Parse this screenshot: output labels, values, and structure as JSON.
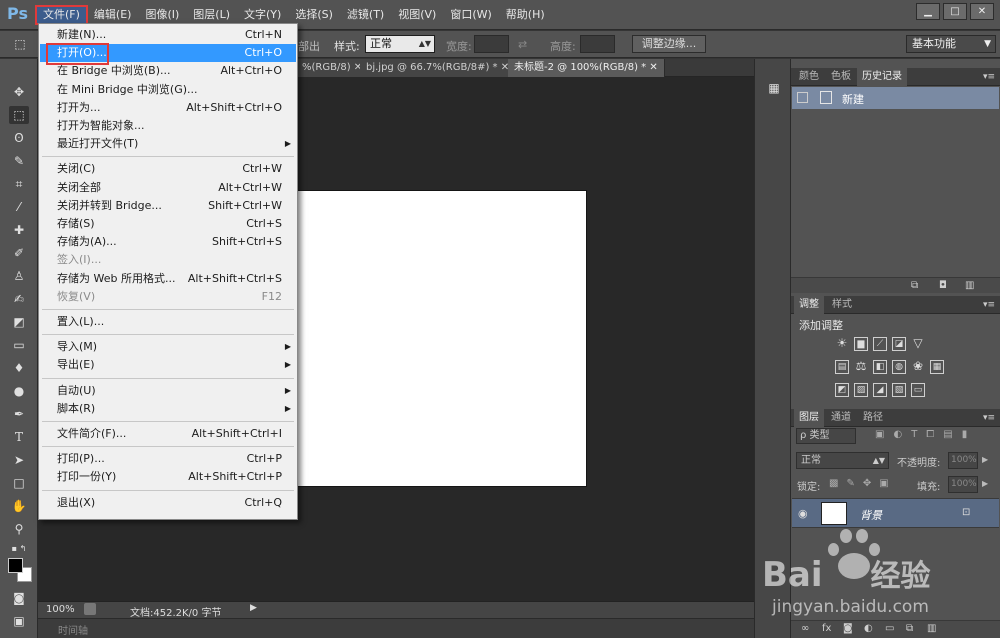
{
  "app": {
    "logo": "Ps"
  },
  "menubar": {
    "items": [
      "文件(F)",
      "编辑(E)",
      "图像(I)",
      "图层(L)",
      "文字(Y)",
      "选择(S)",
      "滤镜(T)",
      "视图(V)",
      "窗口(W)",
      "帮助(H)"
    ],
    "active": "文件(F)"
  },
  "window_controls": [
    "▁",
    "□",
    "✕"
  ],
  "options": {
    "partial_label": "部出",
    "style_label": "样式:",
    "style_value": "正常",
    "width_label": "宽度:",
    "height_label": "高度:",
    "refine_button": "调整边缘...",
    "workspace": "基本功能"
  },
  "tabs": [
    {
      "label": "%(RGB/8)",
      "active": false
    },
    {
      "label": "bj.jpg @ 66.7%(RGB/8#) *",
      "active": false
    },
    {
      "label": "未标题-2 @ 100%(RGB/8) *",
      "active": true
    }
  ],
  "tab_close": "✕",
  "status": {
    "zoom": "100%",
    "doc_size": "文档:452.2K/0 字节"
  },
  "timeline": {
    "label": "时间轴"
  },
  "file_menu": {
    "items": [
      {
        "label": "新建(N)...",
        "shortcut": "Ctrl+N"
      },
      {
        "label": "打开(O)...",
        "shortcut": "Ctrl+O",
        "highlighted": true
      },
      {
        "label": "在 Bridge 中浏览(B)...",
        "shortcut": "Alt+Ctrl+O"
      },
      {
        "label": "在 Mini Bridge 中浏览(G)...",
        "shortcut": ""
      },
      {
        "label": "打开为...",
        "shortcut": "Alt+Shift+Ctrl+O"
      },
      {
        "label": "打开为智能对象...",
        "shortcut": ""
      },
      {
        "label": "最近打开文件(T)",
        "shortcut": "",
        "submenu": true
      },
      {
        "label": "关闭(C)",
        "shortcut": "Ctrl+W"
      },
      {
        "label": "关闭全部",
        "shortcut": "Alt+Ctrl+W"
      },
      {
        "label": "关闭并转到 Bridge...",
        "shortcut": "Shift+Ctrl+W"
      },
      {
        "label": "存储(S)",
        "shortcut": "Ctrl+S"
      },
      {
        "label": "存储为(A)...",
        "shortcut": "Shift+Ctrl+S"
      },
      {
        "label": "签入(I)...",
        "shortcut": "",
        "disabled": true
      },
      {
        "label": "存储为 Web 所用格式...",
        "shortcut": "Alt+Shift+Ctrl+S"
      },
      {
        "label": "恢复(V)",
        "shortcut": "F12",
        "disabled": true
      },
      {
        "label": "置入(L)...",
        "shortcut": ""
      },
      {
        "label": "导入(M)",
        "shortcut": "",
        "submenu": true
      },
      {
        "label": "导出(E)",
        "shortcut": "",
        "submenu": true
      },
      {
        "label": "自动(U)",
        "shortcut": "",
        "submenu": true
      },
      {
        "label": "脚本(R)",
        "shortcut": "",
        "submenu": true
      },
      {
        "label": "文件简介(F)...",
        "shortcut": "Alt+Shift+Ctrl+I"
      },
      {
        "label": "打印(P)...",
        "shortcut": "Ctrl+P"
      },
      {
        "label": "打印一份(Y)",
        "shortcut": "Alt+Shift+Ctrl+P"
      },
      {
        "label": "退出(X)",
        "shortcut": "Ctrl+Q"
      }
    ]
  },
  "history_panel": {
    "tabs": [
      "颜色",
      "色板",
      "历史记录"
    ],
    "active_tab": "历史记录",
    "items": [
      "新建"
    ]
  },
  "adjustments_panel": {
    "tabs": [
      "调整",
      "样式"
    ],
    "active_tab": "调整",
    "title": "添加调整"
  },
  "layers_panel": {
    "tabs": [
      "图层",
      "通道",
      "路径"
    ],
    "active_tab": "图层",
    "filter": "ρ 类型",
    "blend_mode": "正常",
    "opacity_label": "不透明度:",
    "opacity_value": "100%",
    "lock_label": "锁定:",
    "fill_label": "填充:",
    "fill_value": "100%",
    "layers": [
      {
        "name": "背景",
        "locked": true
      }
    ]
  },
  "watermark": {
    "brand": "Bai",
    "brand_cn": "经验",
    "url": "jingyan.baidu.com"
  },
  "colors": {
    "menu_highlight": "#3399ff",
    "callout": "#e03a3a",
    "ui_dark": "#535353",
    "canvas_bg": "#282828"
  }
}
